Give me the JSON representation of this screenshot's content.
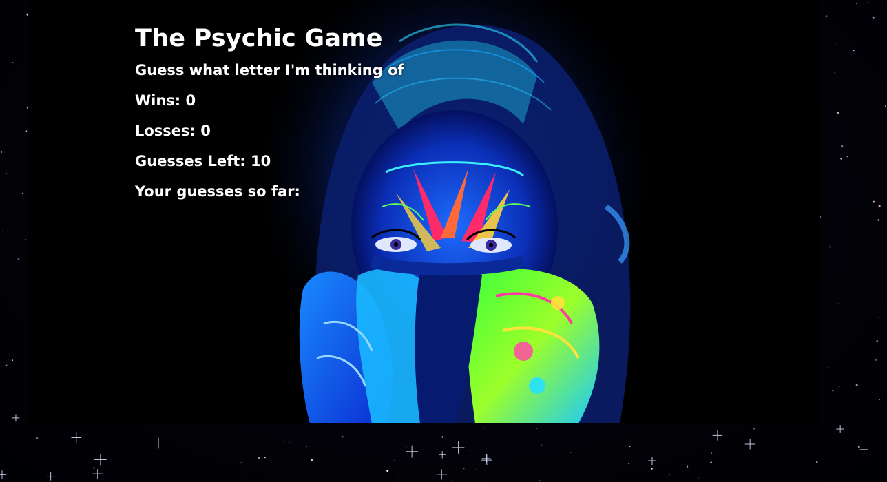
{
  "game": {
    "title": "The Psychic Game",
    "instruction": "Guess what letter I'm thinking of",
    "wins_label": "Wins: ",
    "wins": "0",
    "losses_label": "Losses: ",
    "losses": "0",
    "guesses_left_label": "Guesses Left: ",
    "guesses_left": "10",
    "guesses_so_far_label": "Your guesses so far: ",
    "guesses_so_far": ""
  },
  "colors": {
    "text": "#ffffff",
    "background": "#000000"
  },
  "icons": {
    "background_art": "neon-masked-face-illustration",
    "backdrop": "starfield"
  }
}
